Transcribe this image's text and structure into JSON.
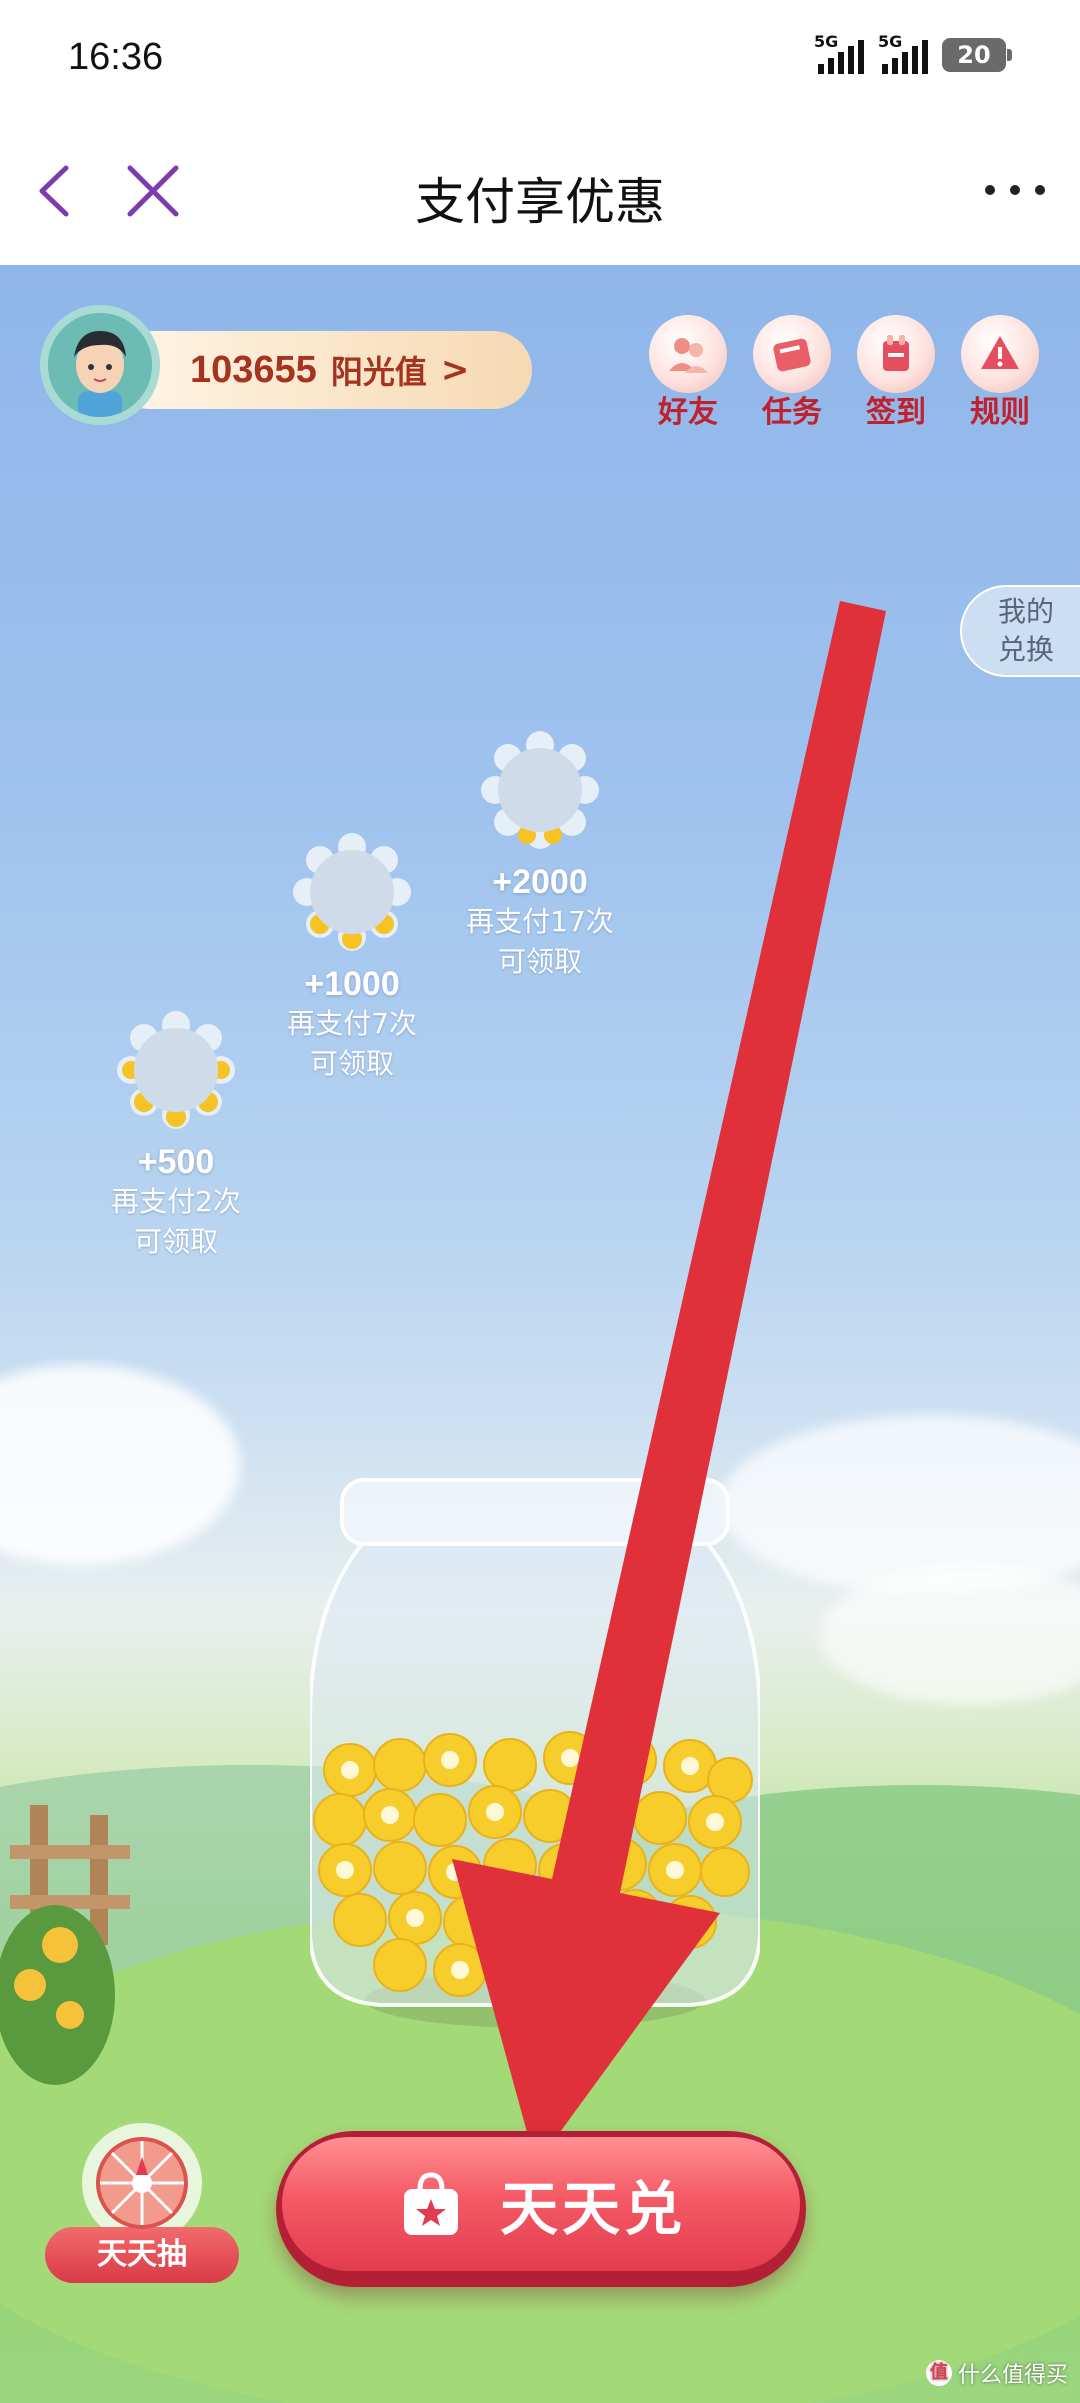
{
  "status_bar": {
    "time": "16:36",
    "signal_1_label": "5G",
    "signal_2_label": "5G",
    "battery": "20"
  },
  "nav": {
    "title": "支付享优惠"
  },
  "user": {
    "sunlight_value": "103655",
    "sunlight_label": "阳光值",
    "chevron": ">"
  },
  "top_actions": [
    {
      "label": "好友",
      "icon": "friends-icon"
    },
    {
      "label": "任务",
      "icon": "task-icon"
    },
    {
      "label": "签到",
      "icon": "checkin-icon"
    },
    {
      "label": "规则",
      "icon": "rules-icon"
    }
  ],
  "my_exchange": {
    "line1": "我的",
    "line2": "兑换"
  },
  "tokens": [
    {
      "amount": "+500",
      "line1": "再支付2次",
      "line2": "可领取"
    },
    {
      "amount": "+1000",
      "line1": "再支付7次",
      "line2": "可领取"
    },
    {
      "amount": "+2000",
      "line1": "再支付17次",
      "line2": "可领取"
    }
  ],
  "bottom": {
    "lottery_label": "天天抽",
    "exchange_label": "天天兑"
  },
  "watermark": {
    "text": "什么值得买",
    "badge": "值"
  },
  "colors": {
    "accent_red": "#e23c4f",
    "sunlight_text": "#a5331f",
    "arrow_red": "#e0303a"
  }
}
